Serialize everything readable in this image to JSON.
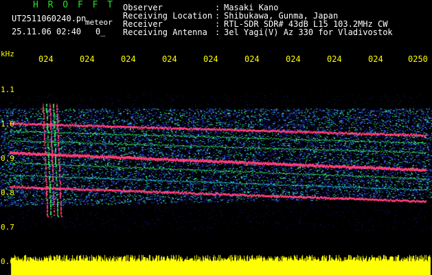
{
  "header": {
    "app_title": "H R O F F T",
    "filename": "UT2511060240.pn",
    "meteor_label": "meteor",
    "datetime": "25.11.06 02:40",
    "counter": "0_"
  },
  "info": [
    {
      "key": "Observer",
      "sep": ":",
      "value": "Masaki Kano"
    },
    {
      "key": "Receiving Location",
      "sep": ":",
      "value": "Shibukawa, Gunma, Japan"
    },
    {
      "key": "Receiver",
      "sep": ":",
      "value": "RTL-SDR SDR# 43dB L15 103.2MHz CW"
    },
    {
      "key": "Receiving Antenna",
      "sep": ":",
      "value": "3el Yagi(V) Az 330 for Vladivostok"
    }
  ],
  "axis": {
    "unit": "kHz",
    "time_ticks": [
      "024",
      "024",
      "024",
      "024",
      "024",
      "024",
      "024",
      "024",
      "024",
      "0250"
    ],
    "freq_ticks": [
      "1.1",
      "1.0",
      "0.9",
      "0.8",
      "0.7",
      "0.6"
    ],
    "freq_range": [
      0.6,
      1.15
    ]
  },
  "colors": {
    "background": "#000000",
    "title_green": "#28e028",
    "text_white": "#ffffff",
    "label_yellow": "#ffff00",
    "noise_dark_blue": "#14147a",
    "noise_blue": "#2f4ad8",
    "noise_cyan": "#20c8d0",
    "noise_green": "#30e060",
    "trace_pink": "#ff3c78",
    "signal_yellow": "#ffff00"
  }
}
